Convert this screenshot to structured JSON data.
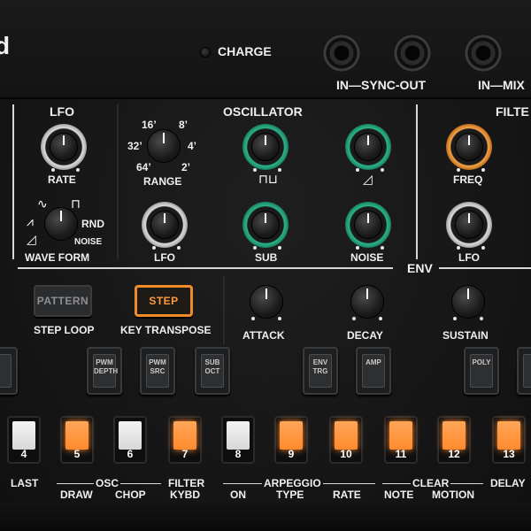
{
  "top": {
    "brand": "d",
    "charge": "CHARGE",
    "in_sync_out": "IN—SYNC-OUT",
    "in_mix": "IN—MIX"
  },
  "sections": {
    "lfo": "LFO",
    "oscillator": "OSCILLATOR",
    "filter": "FILTE",
    "env": "ENV"
  },
  "knobs": {
    "rate": "RATE",
    "range": "RANGE",
    "range_ticks": [
      "16’",
      "8’",
      "32’",
      "4’",
      "64’",
      "2’"
    ],
    "lfo_osc": "LFO",
    "sub": "SUB",
    "noise": "NOISE",
    "freq": "FREQ",
    "lfo_filter": "LFO",
    "wave_form": "WAVE FORM",
    "rnd": "RND",
    "noise_wave": "NOISE",
    "attack": "ATTACK",
    "decay": "DECAY",
    "sustain": "SUSTAIN"
  },
  "buttons": {
    "pattern": "PATTERN",
    "step": "STEP",
    "step_loop": "STEP LOOP",
    "key_transpose": "KEY TRANSPOSE"
  },
  "switches": [
    {
      "label": "PWM\nDEPTH"
    },
    {
      "label": "PWM\nSRC"
    },
    {
      "label": "SUB\nOCT"
    },
    {
      "label": "ENV\nTRG"
    },
    {
      "label": "AMP"
    },
    {
      "label": "POLY"
    }
  ],
  "pads": [
    {
      "num": "4",
      "color": "white",
      "label": "LAST"
    },
    {
      "num": "5",
      "color": "orange",
      "label": "DRAW"
    },
    {
      "num": "6",
      "color": "white",
      "label": "CHOP"
    },
    {
      "num": "7",
      "color": "orange",
      "label": "KYBD"
    },
    {
      "num": "8",
      "color": "white",
      "label": "ON"
    },
    {
      "num": "9",
      "color": "orange",
      "label": "TYPE"
    },
    {
      "num": "10",
      "color": "orange",
      "label": "RATE"
    },
    {
      "num": "11",
      "color": "orange",
      "label": "NOTE"
    },
    {
      "num": "12",
      "color": "orange",
      "label": "MOTION"
    },
    {
      "num": "13",
      "color": "orange",
      "label": "DELAY"
    }
  ],
  "group_labels": {
    "osc": "OSC",
    "filter": "FILTER",
    "arpeggio": "ARPEGGIO",
    "clear": "CLEAR"
  },
  "colors": {
    "accent_orange": "#ff8a2e",
    "accent_green": "#2bb38a",
    "panel": "#161617"
  }
}
